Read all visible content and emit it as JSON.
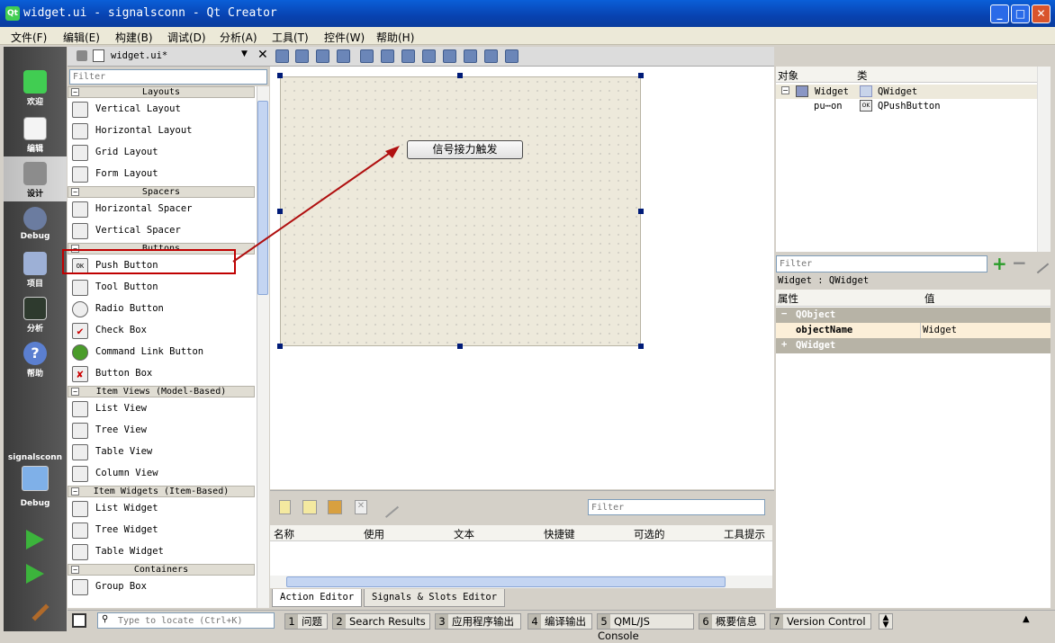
{
  "window": {
    "title": "widget.ui - signalsconn - Qt Creator",
    "minimize": "_",
    "maximize": "□",
    "close": "✕"
  },
  "menu": [
    "文件(F)",
    "编辑(E)",
    "构建(B)",
    "调试(D)",
    "分析(A)",
    "工具(T)",
    "控件(W)",
    "帮助(H)"
  ],
  "modes": [
    "欢迎",
    "编辑",
    "设计",
    "Debug",
    "项目",
    "分析",
    "帮助"
  ],
  "project": {
    "name": "signalsconn",
    "config": "Debug"
  },
  "widgetbox": {
    "file": "widget.ui*",
    "filter_placeholder": "Filter",
    "categories": {
      "layouts": "Layouts",
      "spacers": "Spacers",
      "buttons": "Buttons",
      "item_views": "Item Views (Model-Based)",
      "item_widgets": "Item Widgets (Item-Based)",
      "containers": "Containers"
    },
    "items": {
      "vertical_layout": "Vertical Layout",
      "horizontal_layout": "Horizontal Layout",
      "grid_layout": "Grid Layout",
      "form_layout": "Form Layout",
      "horizontal_spacer": "Horizontal Spacer",
      "vertical_spacer": "Vertical Spacer",
      "push_button": "Push Button",
      "tool_button": "Tool Button",
      "radio_button": "Radio Button",
      "check_box": "Check Box",
      "command_link_button": "Command Link Button",
      "button_box": "Button Box",
      "list_view": "List View",
      "tree_view": "Tree View",
      "table_view": "Table View",
      "column_view": "Column View",
      "list_widget": "List Widget",
      "tree_widget": "Tree Widget",
      "table_widget": "Table Widget",
      "group_box": "Group Box"
    },
    "push_button_icon": "OK"
  },
  "form": {
    "button_text": "信号接力触发"
  },
  "action_editor": {
    "filter_placeholder": "Filter",
    "columns": [
      "名称",
      "使用",
      "文本",
      "快捷键",
      "可选的",
      "工具提示"
    ],
    "tabs": [
      "Action Editor",
      "Signals & Slots Editor"
    ]
  },
  "object_inspector": {
    "columns": [
      "对象",
      "类"
    ],
    "rows": [
      {
        "object": "Widget",
        "class": "QWidget"
      },
      {
        "object": "pu⋯on",
        "class": "QPushButton"
      }
    ]
  },
  "property_editor": {
    "filter_placeholder": "Filter",
    "label": "Widget : QWidget",
    "columns": [
      "属性",
      "值"
    ],
    "groups": {
      "qobject": "QObject",
      "qwidget": "QWidget"
    },
    "object_name": {
      "name": "objectName",
      "value": "Widget"
    }
  },
  "statusbar": {
    "locator_placeholder": "Type to locate (Ctrl+K)",
    "panes": [
      {
        "num": "1",
        "label": "问题"
      },
      {
        "num": "2",
        "label": "Search Results"
      },
      {
        "num": "3",
        "label": "应用程序输出"
      },
      {
        "num": "4",
        "label": "编译输出"
      },
      {
        "num": "5",
        "label": "QML/JS Console"
      },
      {
        "num": "6",
        "label": "概要信息"
      },
      {
        "num": "7",
        "label": "Version Control"
      }
    ]
  },
  "colors": {
    "titlebar": "#0a5fd8",
    "highlight_box": "#c00000",
    "arrow": "#b01010",
    "form_bg": "#ede9db"
  }
}
